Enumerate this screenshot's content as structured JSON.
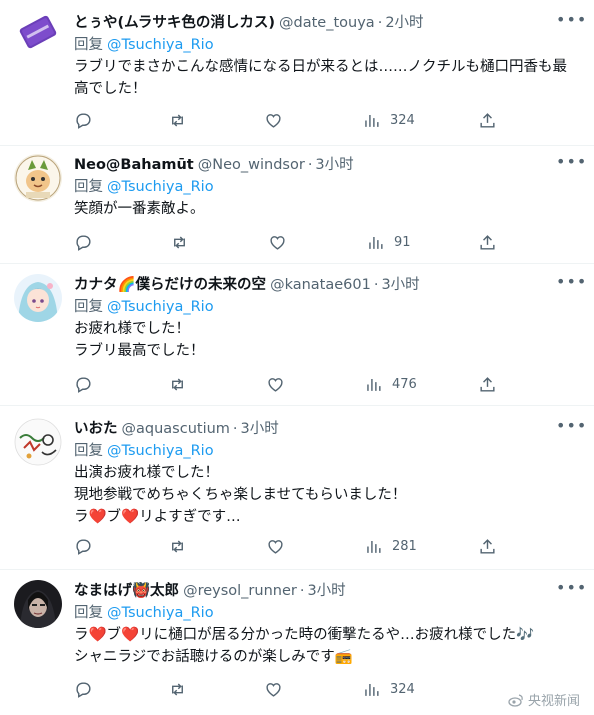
{
  "tweets": [
    {
      "display_name": "とぅや(ムラサキ色の消しカス)",
      "handle": "@date_touya",
      "time": "2小时",
      "reply_label": "回复",
      "reply_to": "@Tsuchiya_Rio",
      "lines": [
        "ラブリでまさかこんな感情になる日が来るとは……ノクチルも樋口円香も最",
        "高でした！"
      ],
      "views": "324",
      "avatar_icon": "purple-eraser-avatar"
    },
    {
      "display_name": "Neo@Bahamūt",
      "handle": "@Neo_windsor",
      "time": "3小时",
      "reply_label": "回复",
      "reply_to": "@Tsuchiya_Rio",
      "lines": [
        "笑顔が一番素敵よ。"
      ],
      "views": "91",
      "avatar_icon": "cartoon-character-avatar"
    },
    {
      "display_name": "カナタ🌈僕らだけの未来の空",
      "handle": "@kanatae601",
      "time": "3小时",
      "reply_label": "回复",
      "reply_to": "@Tsuchiya_Rio",
      "lines": [
        "お疲れ様でした！",
        "ラブリ最高でした！"
      ],
      "views": "476",
      "avatar_icon": "anime-girl-avatar"
    },
    {
      "display_name": "いおた",
      "handle": "@aquascutium",
      "time": "3小时",
      "reply_label": "回复",
      "reply_to": "@Tsuchiya_Rio",
      "lines": [
        "出演お疲れ様でした！",
        "現地参戦でめちゃくちゃ楽しませてもらいました！",
        "ラ❤️ブ❤️リよすぎです…"
      ],
      "views": "281",
      "avatar_icon": "doodle-avatar"
    },
    {
      "display_name": "なまはげ👹太郎",
      "handle": "@reysol_runner",
      "time": "3小时",
      "reply_label": "回复",
      "reply_to": "@Tsuchiya_Rio",
      "lines": [
        "ラ❤️ブ❤️リに樋口が居る分かった時の衝撃たるや…お疲れ様でした🎶",
        "シャニラジでお話聴けるのが楽しみです📻"
      ],
      "views": "324",
      "avatar_icon": "dark-portrait-avatar"
    }
  ],
  "icons": {
    "reply": "reply-icon",
    "retweet": "retweet-icon",
    "like": "like-icon",
    "views": "views-icon",
    "share": "share-icon",
    "more": "more-icon"
  },
  "colors": {
    "link": "#1d9bf0",
    "muted": "#536471",
    "text": "#0f1419",
    "divider": "#eff3f4"
  },
  "watermark": "央视新闻"
}
